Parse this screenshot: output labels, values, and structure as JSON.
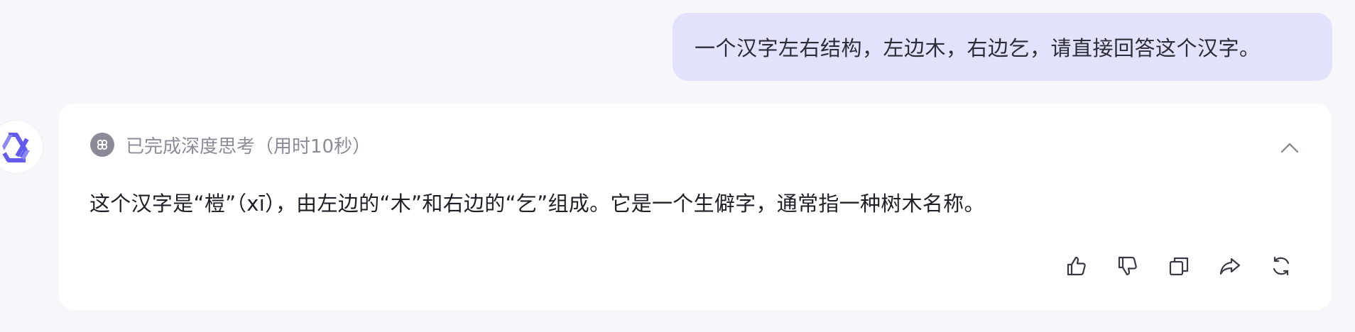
{
  "user_message": {
    "text": "一个汉字左右结构，左边木，右边乞，请直接回答这个汉字。"
  },
  "assistant": {
    "avatar_icon": "assistant-logo-icon",
    "thinking": {
      "label": "已完成深度思考（用时10秒）",
      "icon": "thinking-icon",
      "expanded": true
    },
    "answer": "这个汉字是“榿”（xī），由左边的“木”和右边的“乞”组成。它是一个生僻字，通常指一种树木名称。",
    "actions": [
      {
        "name": "like",
        "icon": "thumbs-up-icon"
      },
      {
        "name": "dislike",
        "icon": "thumbs-down-icon"
      },
      {
        "name": "copy",
        "icon": "copy-icon"
      },
      {
        "name": "share",
        "icon": "share-icon"
      },
      {
        "name": "regenerate",
        "icon": "refresh-icon"
      }
    ]
  },
  "colors": {
    "page_bg": "#f7f7fb",
    "user_bubble_bg": "#e2e2fd",
    "card_bg": "#ffffff",
    "brand": "#615ced",
    "muted_text": "#8c8c99"
  }
}
